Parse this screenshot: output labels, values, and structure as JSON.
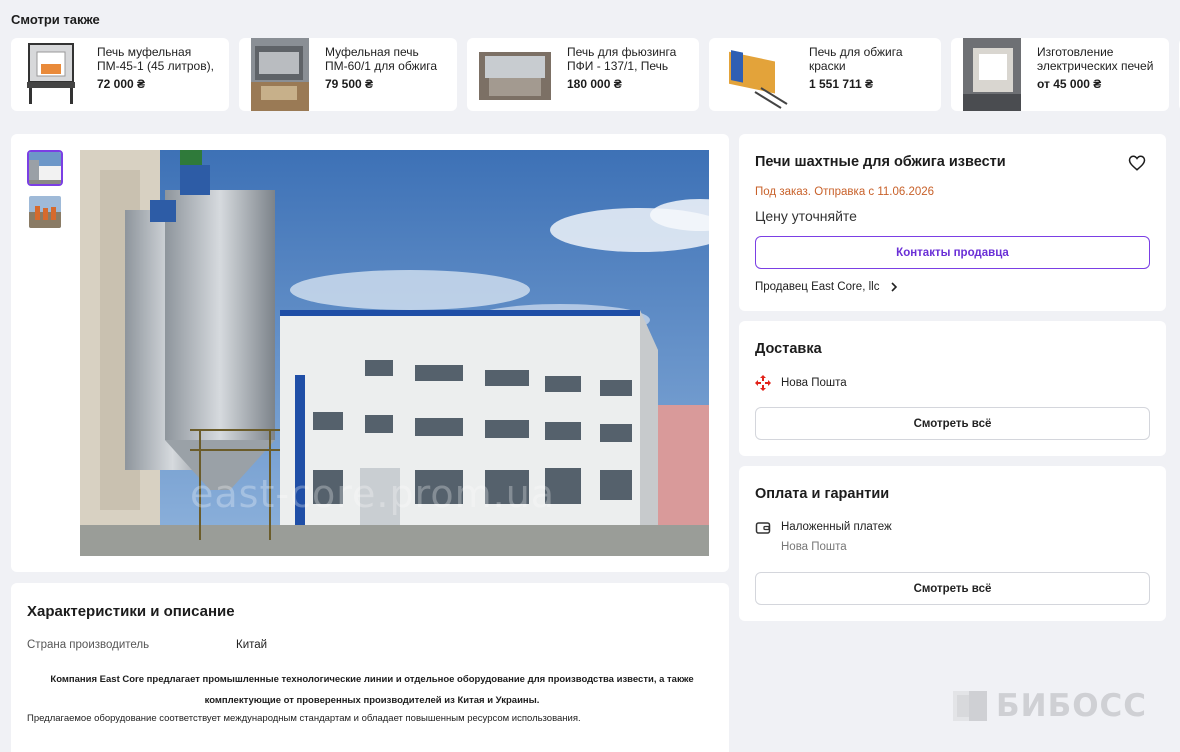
{
  "see_also": {
    "title": "Смотри также",
    "items": [
      {
        "name": "Печь муфельная ПМ-45-1 (45 литров),",
        "price": "72 000 ₴"
      },
      {
        "name": "Муфельная печь ПМ-60/1 для обжига",
        "price": "79 500 ₴"
      },
      {
        "name": "Печь для фьюзинга ПФИ - 137/1, Печь для",
        "price": "180 000 ₴"
      },
      {
        "name": "Печь для обжига краски",
        "price": "1 551 711 ₴"
      },
      {
        "name": "Изготовление электрических печей",
        "price": "от 45 000 ₴"
      }
    ]
  },
  "gallery": {
    "watermark": "east-core.prom.ua"
  },
  "product": {
    "title": "Печи шахтные для обжига извести",
    "availability": "Под заказ. Отправка с 11.06.2026",
    "price_note": "Цену уточняйте",
    "contact_button": "Контакты продавца",
    "seller": "Продавец East Core, llc"
  },
  "delivery": {
    "title": "Доставка",
    "method": "Нова Пошта",
    "see_all": "Смотреть всё"
  },
  "payment": {
    "title": "Оплата и гарантии",
    "method": "Наложенный платеж",
    "method_sub": "Нова Пошта",
    "see_all": "Смотреть всё"
  },
  "description": {
    "title": "Характеристики и описание",
    "spec_label": "Страна производитель",
    "spec_value": "Китай",
    "bold_text": "Компания East Core предлагает промышленные технологические линии и отдельное оборудование для производства извести, а также комплектующие от проверенных производителей из Китая и Украины.",
    "text": "Предлагаемое оборудование соответствует международным стандартам и обладает повышенным ресурсом использования."
  },
  "logo": {
    "text": "БИБОСС"
  },
  "colors": {
    "accent": "#7b3fe4",
    "availability": "#c8612a",
    "background": "#f0f1f5"
  }
}
